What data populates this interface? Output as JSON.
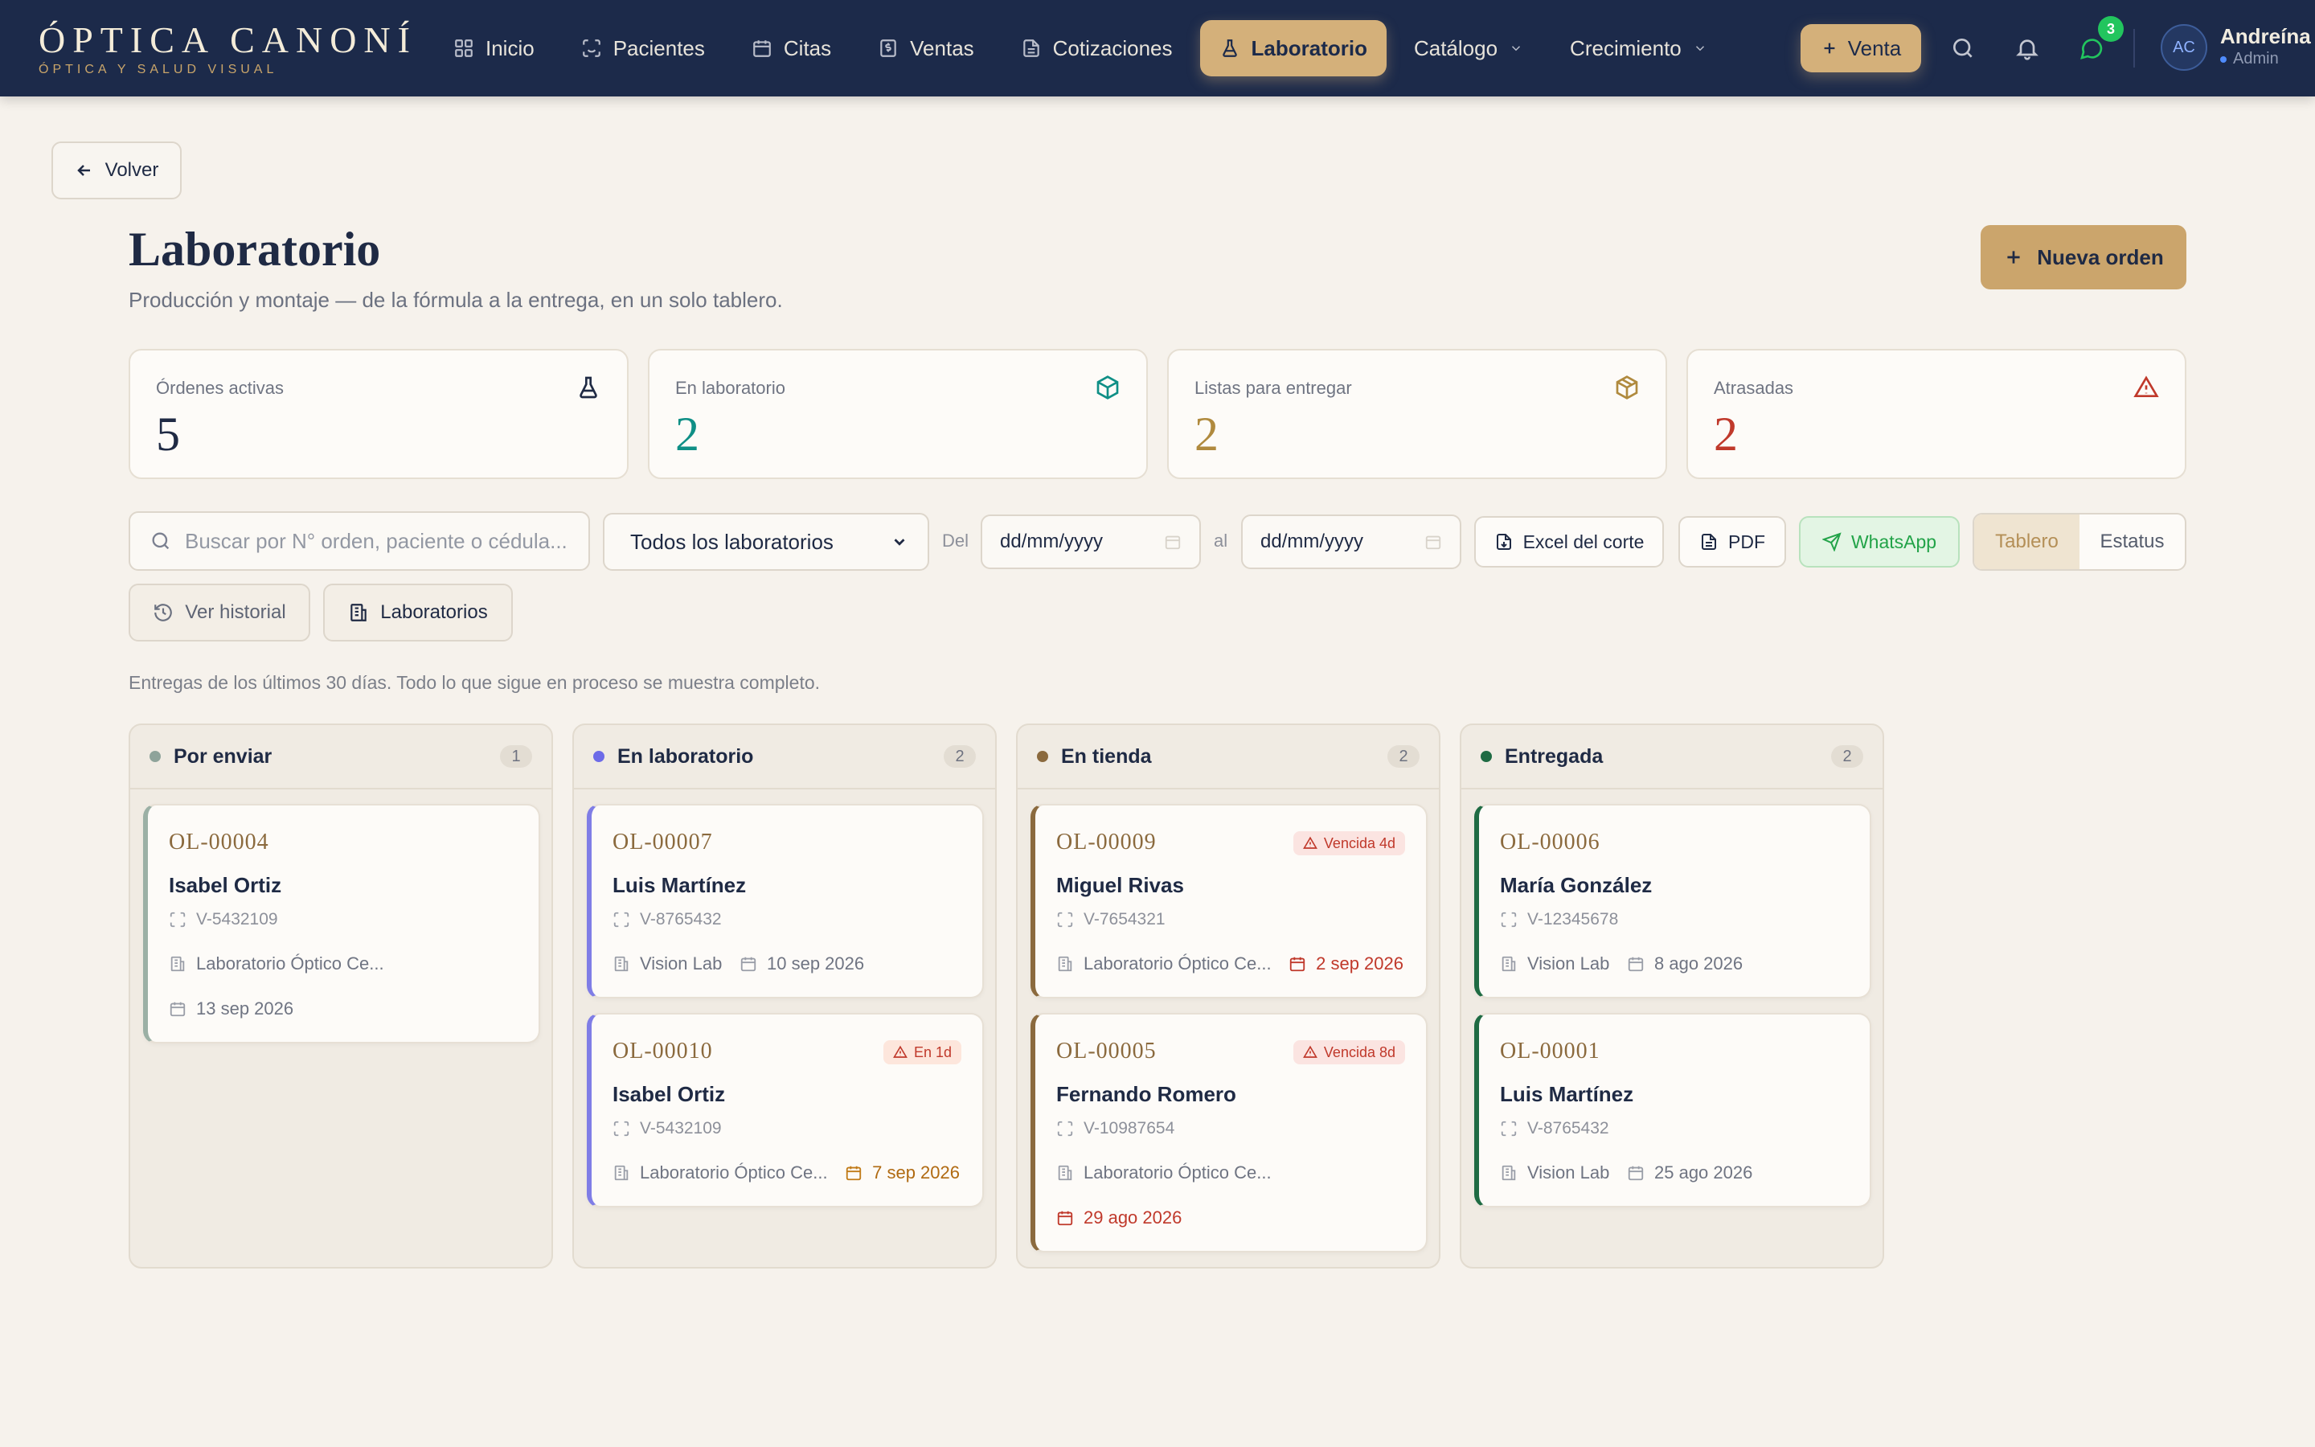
{
  "brand": {
    "name": "ÓPTICA CANONÍ",
    "tagline": "ÓPTICA Y SALUD VISUAL"
  },
  "nav": {
    "items": [
      {
        "label": "Inicio",
        "icon": "grid-icon"
      },
      {
        "label": "Pacientes",
        "icon": "scan-face-icon"
      },
      {
        "label": "Citas",
        "icon": "calendar-icon"
      },
      {
        "label": "Ventas",
        "icon": "receipt-icon"
      },
      {
        "label": "Cotizaciones",
        "icon": "file-text-icon"
      },
      {
        "label": "Laboratorio",
        "icon": "flask-icon",
        "active": true
      },
      {
        "label": "Catálogo",
        "icon": "chevron-down-icon"
      },
      {
        "label": "Crecimiento",
        "icon": "chevron-down-icon"
      }
    ],
    "venta_label": "Venta",
    "messages_count": "3",
    "user": {
      "initials": "AC",
      "name": "Andreína",
      "role": "Admin"
    }
  },
  "page": {
    "back_label": "Volver",
    "title": "Laboratorio",
    "subtitle": "Producción y montaje — de la fórmula a la entrega, en un solo tablero.",
    "new_order_label": "Nueva orden"
  },
  "stats": [
    {
      "label": "Órdenes activas",
      "value": "5",
      "color": "#1f2a44",
      "icon": "flask-icon"
    },
    {
      "label": "En laboratorio",
      "value": "2",
      "color": "#0f8f86",
      "icon": "box-icon"
    },
    {
      "label": "Listas para entregar",
      "value": "2",
      "color": "#b08a3e",
      "icon": "package-icon"
    },
    {
      "label": "Atrasadas",
      "value": "2",
      "color": "#c0392b",
      "icon": "alert-triangle-icon"
    }
  ],
  "toolbar": {
    "search_placeholder": "Buscar por N° orden, paciente o cédula...",
    "lab_filter": "Todos los laboratorios",
    "from_label": "Del",
    "to_label": "al",
    "date_placeholder": "dd/mm/yyyy",
    "excel_label": "Excel del corte",
    "pdf_label": "PDF",
    "whatsapp_label": "WhatsApp",
    "view_board": "Tablero",
    "view_status": "Estatus",
    "history_label": "Ver historial",
    "labs_label": "Laboratorios"
  },
  "note": "Entregas de los últimos 30 días. Todo lo que sigue en proceso se muestra completo.",
  "columns": [
    {
      "title": "Por enviar",
      "count": "1",
      "dot": "#8ea39a",
      "accent": "#9bb0a5",
      "cards": [
        {
          "id": "OL-00004",
          "name": "Isabel Ortiz",
          "doc": "V-5432109",
          "lab": "Laboratorio Óptico Ce...",
          "date": "13 sep 2026",
          "date_style": "normal",
          "date_row": "below"
        }
      ]
    },
    {
      "title": "En laboratorio",
      "count": "2",
      "dot": "#6d6be8",
      "accent": "#7f7de6",
      "cards": [
        {
          "id": "OL-00007",
          "name": "Luis Martínez",
          "doc": "V-8765432",
          "lab": "Vision Lab",
          "date": "10 sep 2026",
          "date_style": "normal",
          "date_row": "inline"
        },
        {
          "id": "OL-00010",
          "name": "Isabel Ortiz",
          "doc": "V-5432109",
          "lab": "Laboratorio Óptico Ce...",
          "date": "7 sep 2026",
          "date_style": "orange",
          "date_row": "right",
          "badge": "En 1d"
        }
      ]
    },
    {
      "title": "En tienda",
      "count": "2",
      "dot": "#8b6a3e",
      "accent": "#8b6a3e",
      "cards": [
        {
          "id": "OL-00009",
          "name": "Miguel Rivas",
          "doc": "V-7654321",
          "lab": "Laboratorio Óptico Ce...",
          "date": "2 sep 2026",
          "date_style": "red",
          "date_row": "right",
          "badge": "Vencida 4d"
        },
        {
          "id": "OL-00005",
          "name": "Fernando Romero",
          "doc": "V-10987654",
          "lab": "Laboratorio Óptico Ce...",
          "date": "29 ago 2026",
          "date_style": "red",
          "date_row": "below",
          "badge": "Vencida 8d"
        }
      ]
    },
    {
      "title": "Entregada",
      "count": "2",
      "dot": "#1f6b43",
      "accent": "#1f6b43",
      "cards": [
        {
          "id": "OL-00006",
          "name": "María González",
          "doc": "V-12345678",
          "lab": "Vision Lab",
          "date": "8 ago 2026",
          "date_style": "normal",
          "date_row": "inline"
        },
        {
          "id": "OL-00001",
          "name": "Luis Martínez",
          "doc": "V-8765432",
          "lab": "Vision Lab",
          "date": "25 ago 2026",
          "date_style": "normal",
          "date_row": "inline"
        }
      ]
    }
  ]
}
